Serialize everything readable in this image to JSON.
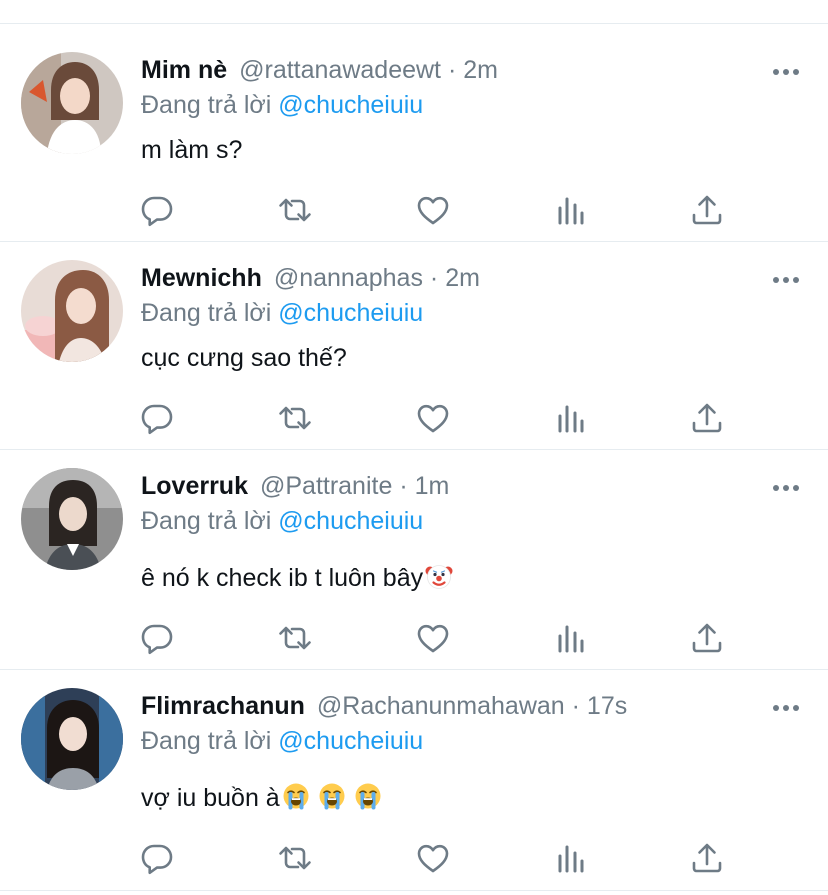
{
  "colors": {
    "accent": "#1d9bf0",
    "muted": "#6e7b86",
    "text": "#0f1419",
    "divider": "#e6ecf0"
  },
  "replies": [
    {
      "name": "Mim nè",
      "handle": "@rattanawadeewt",
      "dot": "·",
      "time": "2m",
      "replying_prefix": "Đang trả lời",
      "replying_to": "@chucheiuiu",
      "text": "m làm s?",
      "emojis": []
    },
    {
      "name": "Mewnichh",
      "handle": "@nannaphas",
      "dot": "·",
      "time": "2m",
      "replying_prefix": "Đang trả lời",
      "replying_to": "@chucheiuiu",
      "text": "cục cưng sao thế?",
      "emojis": []
    },
    {
      "name": "Loverruk",
      "handle": "@Pattranite",
      "dot": "·",
      "time": "1m",
      "replying_prefix": "Đang trả lời",
      "replying_to": "@chucheiuiu",
      "text": "ê nó k check ib t luôn bây",
      "emojis": [
        "clown-face-emoji"
      ]
    },
    {
      "name": "Flimrachanun",
      "handle": "@Rachanunmahawan",
      "dot": "·",
      "time": "17s",
      "replying_prefix": "Đang trả lời",
      "replying_to": "@chucheiuiu",
      "text": "vợ iu buồn à",
      "emojis": [
        "loudly-crying-face-emoji",
        "loudly-crying-face-emoji",
        "loudly-crying-face-emoji"
      ]
    }
  ],
  "action_icons": [
    "reply-icon",
    "retweet-icon",
    "like-icon",
    "analytics-icon",
    "share-icon"
  ],
  "more_icon": "more-options-icon"
}
